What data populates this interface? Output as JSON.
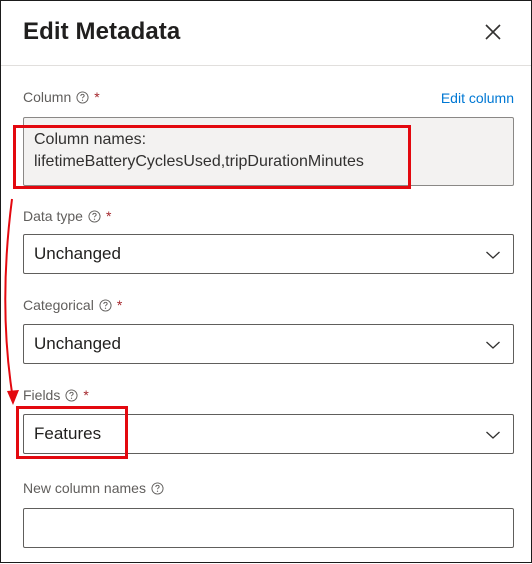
{
  "dialog": {
    "title": "Edit Metadata"
  },
  "column": {
    "label": "Column",
    "required": "*",
    "edit_link": "Edit column",
    "names_heading": "Column names:",
    "names_value": "lifetimeBatteryCyclesUsed,tripDurationMinutes"
  },
  "data_type": {
    "label": "Data type",
    "required": "*",
    "value": "Unchanged"
  },
  "categorical": {
    "label": "Categorical",
    "required": "*",
    "value": "Unchanged"
  },
  "fields": {
    "label": "Fields",
    "required": "*",
    "value": "Features"
  },
  "new_column_names": {
    "label": "New column names",
    "value": ""
  },
  "colors": {
    "annotation": "#e3080f",
    "link": "#0078d4",
    "required": "#a4262c"
  },
  "icons": {
    "close": "close-icon",
    "help": "help-icon",
    "chevron": "chevron-down-icon"
  }
}
